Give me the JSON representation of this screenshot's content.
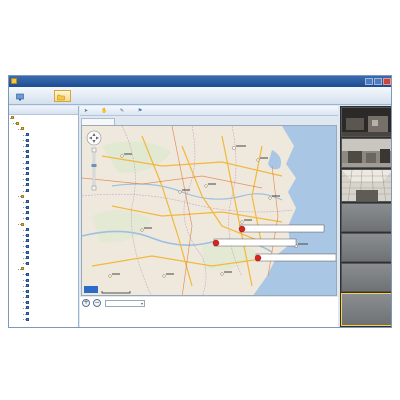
{
  "window": {
    "title": "",
    "user_text": "",
    "min_glyph": "",
    "max_glyph": "",
    "close_glyph": ""
  },
  "toolbar": {
    "left_label": "",
    "left_icon": "monitor-icon",
    "active_label": "",
    "active_icon": "folder-icon"
  },
  "tree": {
    "header": "",
    "rows": [
      "",
      "",
      "",
      "",
      "",
      "",
      "",
      "",
      "",
      "",
      "",
      "",
      "",
      "",
      "",
      "",
      "",
      "",
      "",
      "",
      "",
      "",
      "",
      "",
      "",
      "",
      "",
      "",
      "",
      "",
      "",
      "",
      "",
      "",
      "",
      "",
      ""
    ]
  },
  "map_toolbar": {
    "buttons": [
      {
        "label": "",
        "icon": "cursor-icon"
      },
      {
        "label": "",
        "icon": "hand-icon"
      },
      {
        "label": "",
        "icon": "ruler-icon"
      },
      {
        "label": "",
        "icon": "flag-icon"
      }
    ]
  },
  "map": {
    "tab_label": "",
    "markers": [
      {
        "label": "",
        "color": "#d9231c"
      },
      {
        "label": "",
        "color": "#d9231c"
      },
      {
        "label": "",
        "color": "#d9231c"
      }
    ],
    "scale_text": "",
    "logo_text": ""
  },
  "map_bottom": {
    "zoom_in": "+",
    "zoom_out": "−",
    "select_value": ""
  },
  "video": {
    "cells": [
      {
        "caption": "",
        "type": "dark-room"
      },
      {
        "caption": "",
        "type": "room"
      },
      {
        "caption": "",
        "type": "ceiling"
      },
      {
        "caption": "",
        "type": "empty"
      },
      {
        "caption": "",
        "type": "empty"
      },
      {
        "caption": "",
        "type": "empty"
      },
      {
        "caption": "",
        "type": "empty"
      }
    ]
  },
  "watermark": {
    "company": "",
    "brand": "",
    "url": ""
  },
  "colors": {
    "titlebar": "#1d4b93",
    "accent": "#d7a739",
    "marker": "#d9231c",
    "selected_cell": "#ffd23a"
  }
}
